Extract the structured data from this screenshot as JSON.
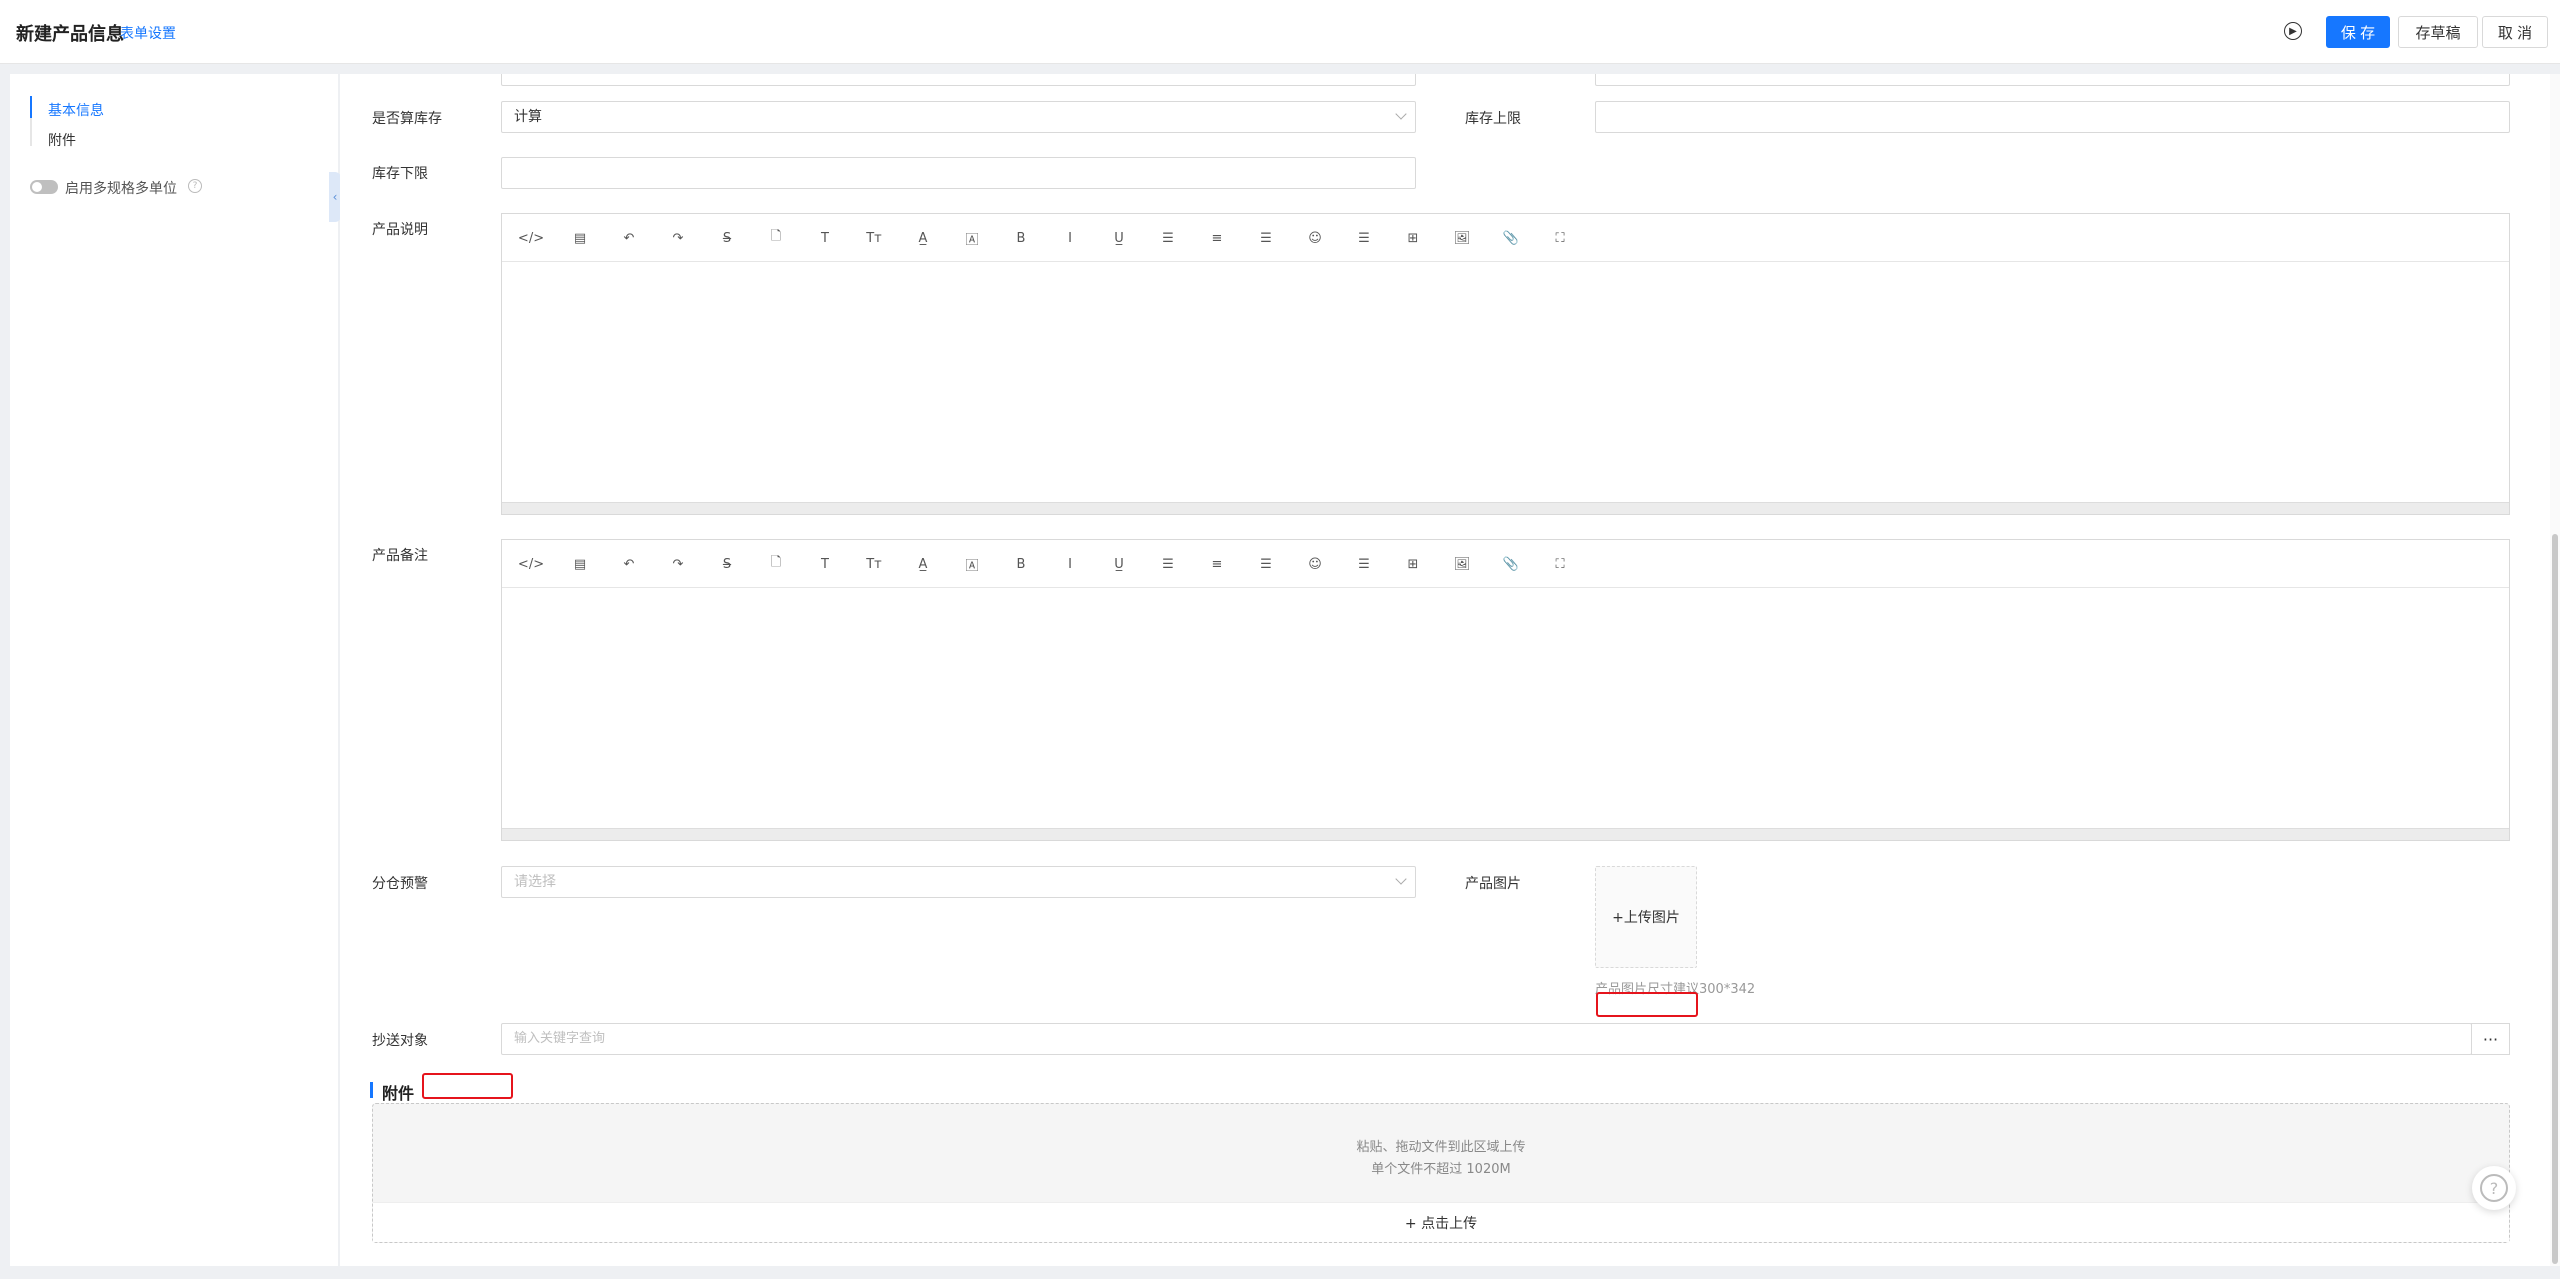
{
  "header": {
    "title": "新建产品信息",
    "form_settings": "表单设置",
    "guide_icon": "play-circle-icon",
    "save_label": "保 存",
    "draft_label": "存草稿",
    "cancel_label": "取 消"
  },
  "sidebar": {
    "items": [
      {
        "label": "基本信息",
        "active": true
      },
      {
        "label": "附件",
        "active": false
      }
    ],
    "toggle_label": "启用多规格多单位",
    "toggle_on": false
  },
  "form": {
    "calc_stock_label": "是否算库存",
    "calc_stock_value": "计算",
    "stock_upper_label": "库存上限",
    "stock_lower_label": "库存下限",
    "desc_label": "产品说明",
    "remark_label": "产品备注",
    "warehouse_warn_label": "分仓预警",
    "warehouse_warn_placeholder": "请选择",
    "image_label": "产品图片",
    "upload_image_label": "+上传图片",
    "image_hint": "产品图片尺寸建议300*342",
    "cc_label": "抄送对象",
    "cc_placeholder": "输入关键字查询",
    "more_label": "···"
  },
  "editor_toolbar": [
    {
      "name": "code-view-icon",
      "glyph": "</>"
    },
    {
      "name": "template-icon",
      "glyph": "▤"
    },
    {
      "name": "undo-icon",
      "glyph": "↶"
    },
    {
      "name": "redo-icon",
      "glyph": "↷"
    },
    {
      "name": "strikethrough-icon",
      "glyph": "S̶"
    },
    {
      "name": "document-icon",
      "glyph": "🗋"
    },
    {
      "name": "text-icon",
      "glyph": "T"
    },
    {
      "name": "font-size-icon",
      "glyph": "Tт"
    },
    {
      "name": "font-color-icon",
      "glyph": "A̲"
    },
    {
      "name": "background-color-icon",
      "glyph": "🄰"
    },
    {
      "name": "bold-icon",
      "glyph": "B"
    },
    {
      "name": "italic-icon",
      "glyph": "I"
    },
    {
      "name": "underline-icon",
      "glyph": "U̲"
    },
    {
      "name": "align-left-icon",
      "glyph": "☰"
    },
    {
      "name": "align-center-icon",
      "glyph": "≡"
    },
    {
      "name": "align-right-icon",
      "glyph": "☰"
    },
    {
      "name": "emoji-icon",
      "glyph": "☺"
    },
    {
      "name": "horizontal-rule-icon",
      "glyph": "☰"
    },
    {
      "name": "table-icon",
      "glyph": "⊞"
    },
    {
      "name": "image-icon",
      "glyph": "🖼"
    },
    {
      "name": "attachment-icon",
      "glyph": "📎"
    },
    {
      "name": "fullscreen-icon",
      "glyph": "⛶"
    }
  ],
  "attachments": {
    "section_title": "附件",
    "drop_line1": "粘贴、拖动文件到此区域上传",
    "drop_line2": "单个文件不超过 1020M",
    "click_upload": "+ 点击上传"
  },
  "help_icon": "question-circle-icon"
}
